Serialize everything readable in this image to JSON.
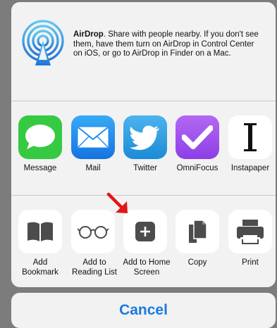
{
  "airdrop": {
    "title": "AirDrop",
    "description": ". Share with people nearby. If you don't see them, have them turn on AirDrop in Control Center on iOS, or go to AirDrop in Finder on a Mac."
  },
  "apps": [
    {
      "label": "Message",
      "icon": "message-icon",
      "color": "#35c944"
    },
    {
      "label": "Mail",
      "icon": "mail-icon",
      "color": "#1f8ef1"
    },
    {
      "label": "Twitter",
      "icon": "twitter-icon",
      "color": "#2a9fe4"
    },
    {
      "label": "OmniFocus",
      "icon": "omnifocus-icon",
      "color": "#9b4df0"
    },
    {
      "label": "Instapaper",
      "icon": "instapaper-icon",
      "color": "#ffffff"
    }
  ],
  "actions": [
    {
      "label": "Add Bookmark",
      "icon": "bookmark-icon"
    },
    {
      "label": "Add to Reading List",
      "icon": "reading-list-icon"
    },
    {
      "label": "Add to Home Screen",
      "icon": "add-home-screen-icon"
    },
    {
      "label": "Copy",
      "icon": "copy-icon"
    },
    {
      "label": "Print",
      "icon": "print-icon"
    }
  ],
  "cancel_label": "Cancel",
  "colors": {
    "accent": "#1a7ae0",
    "arrow": "#e0161a"
  }
}
